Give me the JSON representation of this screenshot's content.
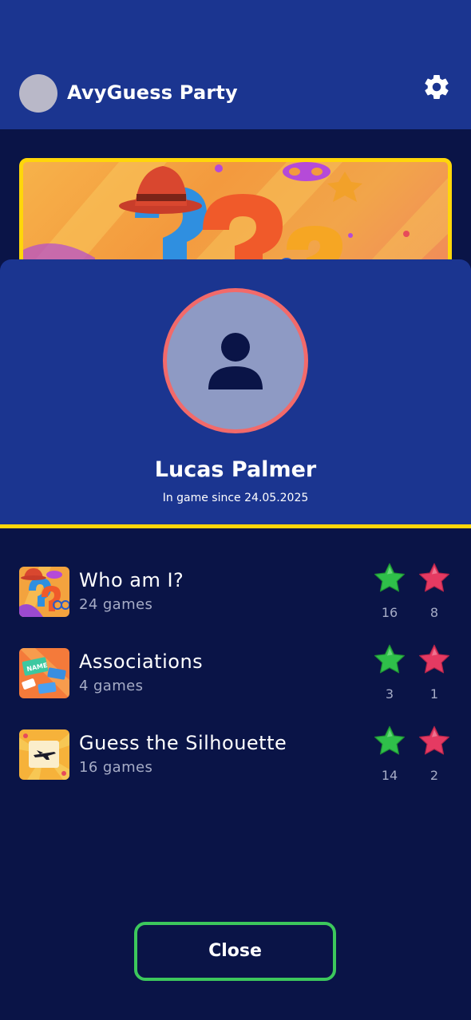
{
  "app": {
    "title": "AvyGuess Party",
    "icons": {
      "avatar": "avatar-circle",
      "settings": "gear-icon"
    }
  },
  "profile": {
    "name": "Lucas Palmer",
    "since": "In game since 24.05.2025",
    "icon": "person-icon"
  },
  "games": [
    {
      "name": "Who am I?",
      "count": "24 games",
      "wins": "16",
      "losses": "8",
      "thumb": "question-marks-thumbnail"
    },
    {
      "name": "Associations",
      "count": "4 games",
      "wins": "3",
      "losses": "1",
      "thumb": "name-cards-thumbnail"
    },
    {
      "name": "Guess the Silhouette",
      "count": "16 games",
      "wins": "14",
      "losses": "2",
      "thumb": "airplane-silhouette-thumbnail"
    }
  ],
  "colors": {
    "header_bg": "#1b3590",
    "page_bg": "#0a1447",
    "accent_yellow": "#ffd60a",
    "win_green": "#2fbf4a",
    "loss_red": "#e53a62",
    "close_border": "#3cc85c",
    "avatar_ring": "#f26a6a"
  },
  "actions": {
    "close_label": "Close"
  }
}
